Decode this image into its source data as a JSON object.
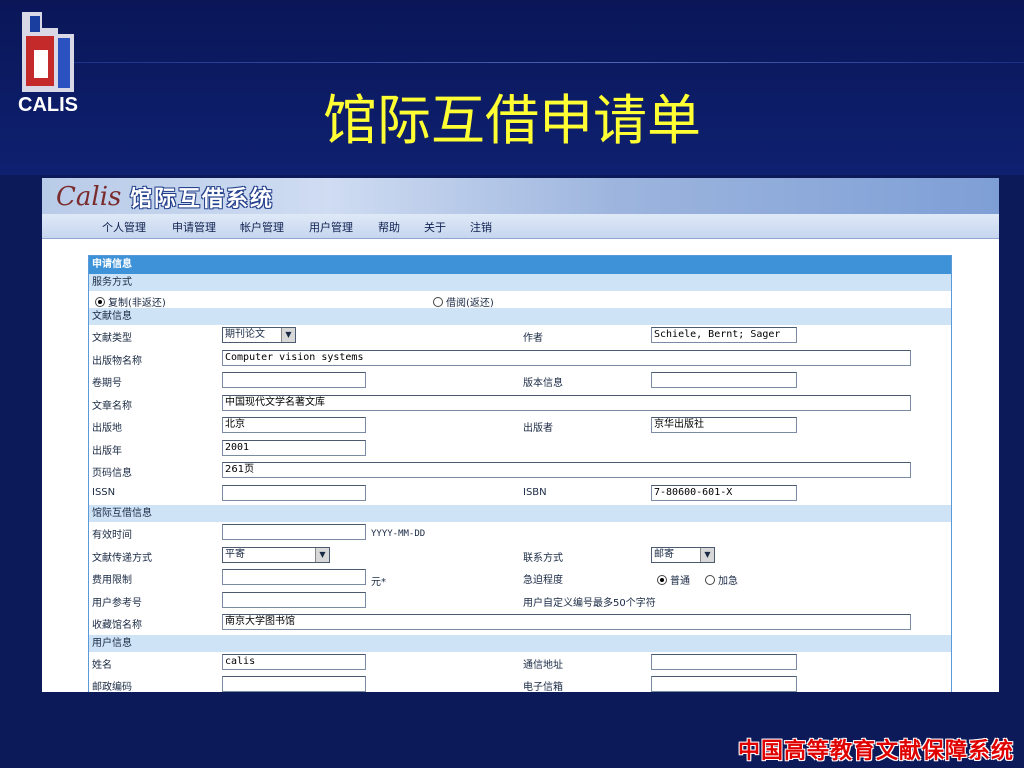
{
  "slide": {
    "logo_text": "CALIS",
    "title": "馆际互借申请单",
    "footer": "中国高等教育文献保障系统"
  },
  "app": {
    "logo_glyph": "Calis",
    "title": "馆际互借系统",
    "menu": [
      "个人管理",
      "申请管理",
      "帐户管理",
      "用户管理",
      "帮助",
      "关于",
      "注销"
    ]
  },
  "form": {
    "header": "申请信息",
    "service": {
      "section": "服务方式",
      "option_copy": "复制(非返还)",
      "option_loan": "借阅(返还)",
      "selected": "复制(非返还)"
    },
    "doc": {
      "section": "文献信息",
      "doc_type_label": "文献类型",
      "doc_type_value": "期刊论文",
      "author_label": "作者",
      "author_value": "Schiele, Bernt; Sager",
      "pub_name_label": "出版物名称",
      "pub_name_value": "Computer vision systems",
      "volume_label": "卷期号",
      "volume_value": "",
      "edition_label": "版本信息",
      "edition_value": "",
      "article_label": "文章名称",
      "article_value": "中国现代文学名著文库",
      "place_label": "出版地",
      "place_value": "北京",
      "publisher_label": "出版者",
      "publisher_value": "京华出版社",
      "year_label": "出版年",
      "year_value": "2001",
      "pages_label": "页码信息",
      "pages_value": "261页",
      "issn_label": "ISSN",
      "issn_value": "",
      "isbn_label": "ISBN",
      "isbn_value": "7-80600-601-X"
    },
    "ill": {
      "section": "馆际互借信息",
      "valid_label": "有效时间",
      "valid_value": "",
      "valid_hint": "YYYY-MM-DD",
      "delivery_label": "文献传递方式",
      "delivery_value": "平寄",
      "contact_label": "联系方式",
      "contact_value": "邮寄",
      "fee_label": "费用限制",
      "fee_value": "",
      "fee_unit": "元*",
      "urgency_label": "急迫程度",
      "urgency_normal": "普通",
      "urgency_rush": "加急",
      "urgency_selected": "普通",
      "ref_label": "用户参考号",
      "ref_value": "",
      "ref_hint": "用户自定义编号最多50个字符",
      "library_label": "收藏馆名称",
      "library_value": "南京大学图书馆"
    },
    "user": {
      "section": "用户信息",
      "name_label": "姓名",
      "name_value": "calis",
      "address_label": "通信地址",
      "address_value": "",
      "zip_label": "邮政编码",
      "zip_value": "",
      "email_label": "电子信箱",
      "email_value": ""
    }
  },
  "colors": {
    "background": "#0c1a5a",
    "title": "#ffff33",
    "form_header": "#3e92d8",
    "section_band": "#cfe3f6",
    "footer": "#e00000"
  }
}
